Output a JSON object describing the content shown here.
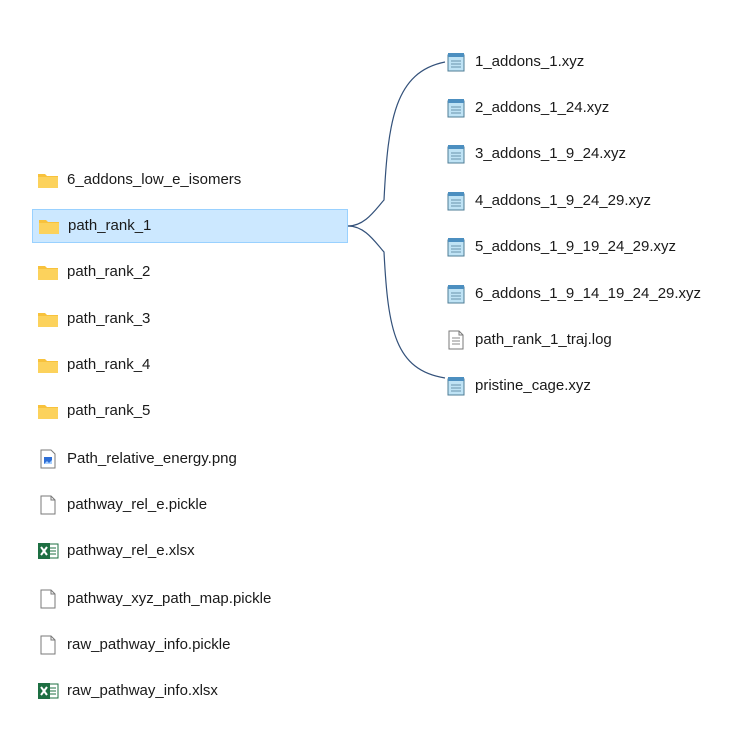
{
  "left_items": [
    {
      "name": "6_addons_low_e_isomers",
      "type": "folder"
    },
    {
      "name": "path_rank_1",
      "type": "folder",
      "selected": true
    },
    {
      "name": "path_rank_2",
      "type": "folder"
    },
    {
      "name": "path_rank_3",
      "type": "folder"
    },
    {
      "name": "path_rank_4",
      "type": "folder"
    },
    {
      "name": "path_rank_5",
      "type": "folder"
    },
    {
      "name": "Path_relative_energy.png",
      "type": "image"
    },
    {
      "name": "pathway_rel_e.pickle",
      "type": "file"
    },
    {
      "name": "pathway_rel_e.xlsx",
      "type": "excel"
    },
    {
      "name": "pathway_xyz_path_map.pickle",
      "type": "file"
    },
    {
      "name": "raw_pathway_info.pickle",
      "type": "file"
    },
    {
      "name": "raw_pathway_info.xlsx",
      "type": "excel"
    }
  ],
  "right_items": [
    {
      "name": "1_addons_1.xyz",
      "type": "notepad"
    },
    {
      "name": "2_addons_1_24.xyz",
      "type": "notepad"
    },
    {
      "name": "3_addons_1_9_24.xyz",
      "type": "notepad"
    },
    {
      "name": "4_addons_1_9_24_29.xyz",
      "type": "notepad"
    },
    {
      "name": "5_addons_1_9_19_24_29.xyz",
      "type": "notepad"
    },
    {
      "name": "6_addons_1_9_14_19_24_29.xyz",
      "type": "notepad"
    },
    {
      "name": "path_rank_1_traj.log",
      "type": "textdoc"
    },
    {
      "name": "pristine_cage.xyz",
      "type": "notepad"
    }
  ],
  "colors": {
    "selection_bg": "#cce8ff",
    "selection_border": "#99d1ff",
    "folder": "#f8c23c",
    "excel": "#1d6f42",
    "connector": "#33517a"
  }
}
